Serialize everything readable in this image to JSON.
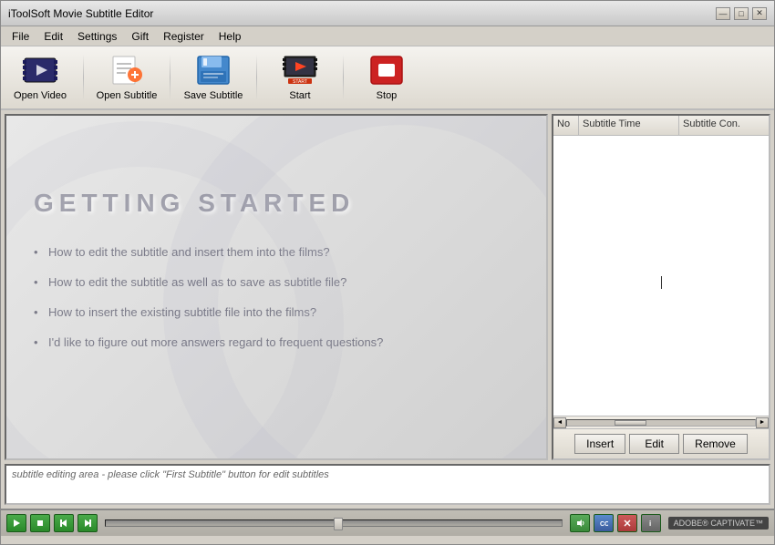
{
  "window": {
    "title": "iToolSoft Movie Subtitle Editor",
    "divider": "|"
  },
  "title_controls": {
    "minimize": "—",
    "restore": "□",
    "close": "✕"
  },
  "menu": {
    "items": [
      "File",
      "Edit",
      "Settings",
      "Gift",
      "Register",
      "Help"
    ]
  },
  "toolbar": {
    "buttons": [
      {
        "id": "open-video",
        "label": "Open Video"
      },
      {
        "id": "open-subtitle",
        "label": "Open Subtitle"
      },
      {
        "id": "save-subtitle",
        "label": "Save Subtitle"
      },
      {
        "id": "start",
        "label": "Start"
      },
      {
        "id": "stop",
        "label": "Stop"
      }
    ]
  },
  "getting_started": {
    "title": "GETTING  STARTED",
    "items": [
      "How to edit the subtitle and insert them into the films?",
      "How to edit the subtitle as well as to save as subtitle file?",
      "How to insert the existing subtitle file into the films?",
      "I'd like to figure out more answers regard to frequent questions?"
    ]
  },
  "subtitle_table": {
    "columns": [
      "No",
      "Subtitle Time",
      "Subtitle Con."
    ],
    "rows": []
  },
  "subtitle_buttons": {
    "insert": "Insert",
    "edit": "Edit",
    "remove": "Remove"
  },
  "subtitle_edit": {
    "placeholder": "subtitle editing area - please click \"First Subtitle\" button for edit subtitles"
  },
  "bottom_controls": {
    "play_tooltip": "Play",
    "stop_tooltip": "Stop",
    "prev_tooltip": "Previous",
    "next_tooltip": "Next",
    "volume_tooltip": "Volume",
    "cc_tooltip": "Closed Captions",
    "close_tooltip": "Close",
    "info_tooltip": "Info"
  },
  "captivate": {
    "label": "ADOBE® CAPTIVATE™"
  }
}
